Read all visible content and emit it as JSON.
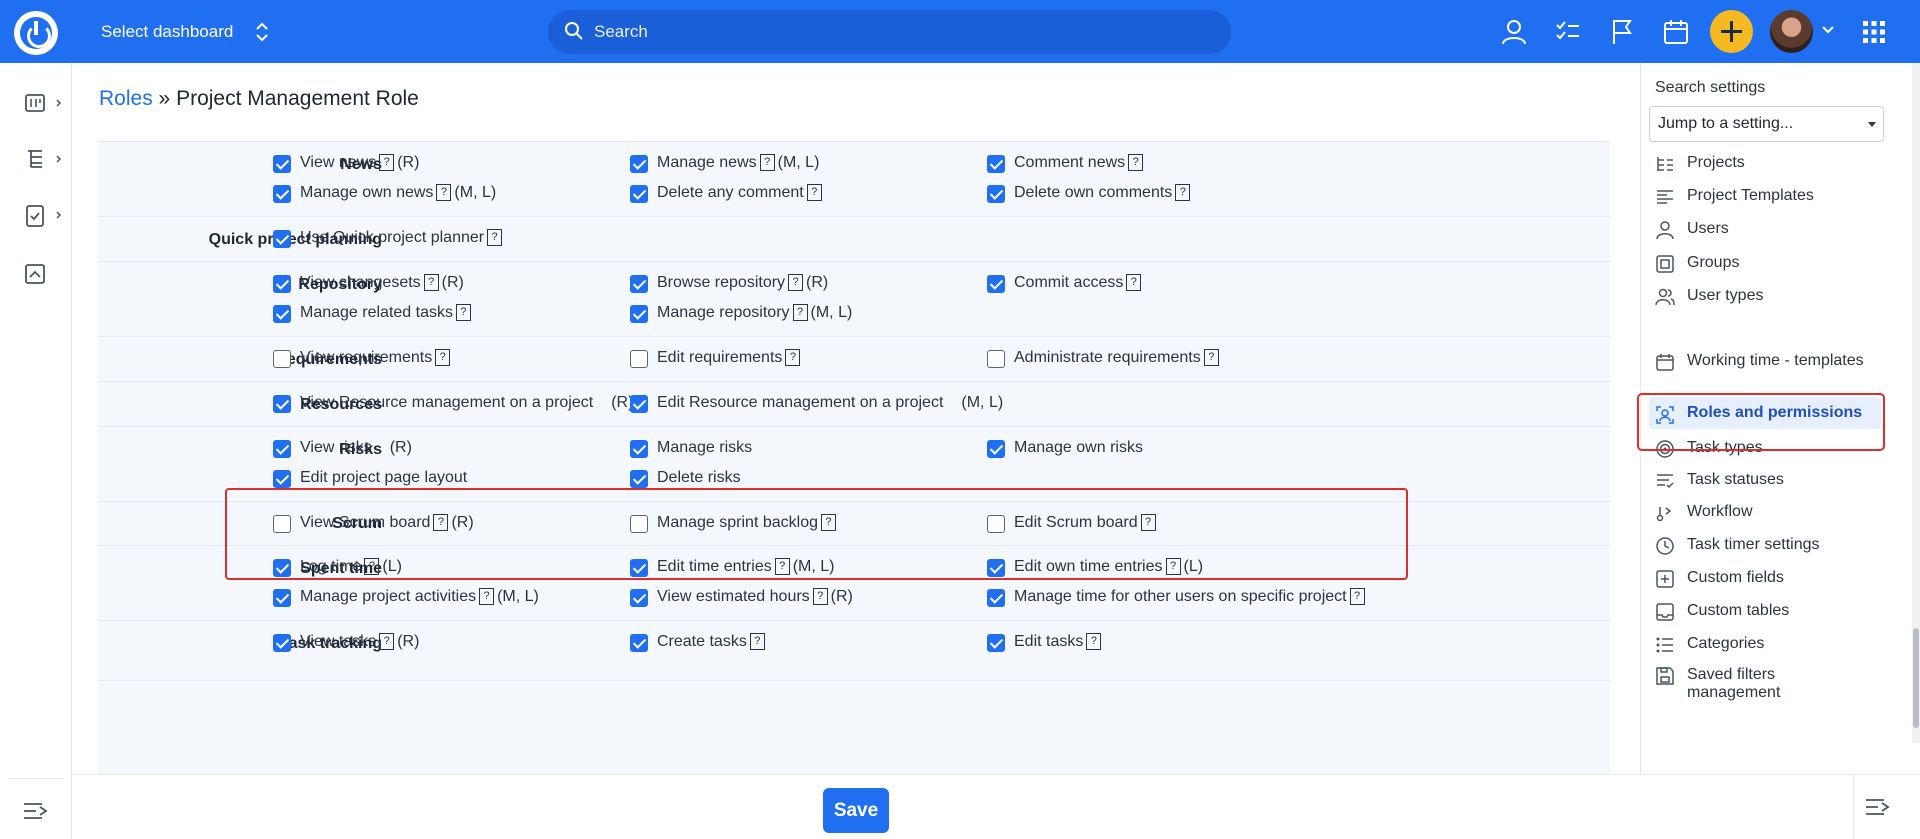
{
  "topbar": {
    "dashboard_select": "Select dashboard",
    "search_placeholder": "Search"
  },
  "breadcrumb": {
    "parent": "Roles",
    "separator": " » ",
    "current": "Project Management Role"
  },
  "permissions": {
    "help_glyph": "?",
    "sections": [
      {
        "label": "News",
        "items": [
          {
            "label": "View news",
            "help": true,
            "suffix": "(R)",
            "checked": true
          },
          {
            "label": "Manage news",
            "help": true,
            "suffix": "(M, L)",
            "checked": true
          },
          {
            "label": "Comment news",
            "help": true,
            "suffix": "",
            "checked": true
          },
          {
            "label": "Manage own news",
            "help": true,
            "suffix": "(M, L)",
            "checked": true
          },
          {
            "label": "Delete any comment",
            "help": true,
            "suffix": "",
            "checked": true
          },
          {
            "label": "Delete own comments",
            "help": true,
            "suffix": "",
            "checked": true
          }
        ]
      },
      {
        "label": "Quick project planning",
        "items": [
          {
            "label": "Use Quick project planner",
            "help": true,
            "suffix": "",
            "checked": true
          }
        ]
      },
      {
        "label": "Repository",
        "items": [
          {
            "label": "View changesets",
            "help": true,
            "suffix": "(R)",
            "checked": true
          },
          {
            "label": "Browse repository",
            "help": true,
            "suffix": "(R)",
            "checked": true
          },
          {
            "label": "Commit access",
            "help": true,
            "suffix": "",
            "checked": true
          },
          {
            "label": "Manage related tasks",
            "help": true,
            "suffix": "",
            "checked": true
          },
          {
            "label": "Manage repository",
            "help": true,
            "suffix": "(M, L)",
            "checked": true
          }
        ]
      },
      {
        "label": "Requirements",
        "items": [
          {
            "label": "View requirements",
            "help": true,
            "suffix": "",
            "checked": false
          },
          {
            "label": "Edit requirements",
            "help": true,
            "suffix": "",
            "checked": false
          },
          {
            "label": "Administrate requirements",
            "help": true,
            "suffix": "",
            "checked": false
          }
        ]
      },
      {
        "label": "Resources",
        "items": [
          {
            "label": "View Resource management on a project",
            "help": false,
            "suffix": "(R)",
            "checked": true
          },
          {
            "label": "Edit Resource management on a project",
            "help": false,
            "suffix": "(M, L)",
            "checked": true
          }
        ]
      },
      {
        "label": "Risks",
        "items": [
          {
            "label": "View risks",
            "help": false,
            "suffix": "(R)",
            "checked": true
          },
          {
            "label": "Manage risks",
            "help": false,
            "suffix": "",
            "checked": true
          },
          {
            "label": "Manage own risks",
            "help": false,
            "suffix": "",
            "checked": true
          },
          {
            "label": "Edit project page layout",
            "help": false,
            "suffix": "",
            "checked": true
          },
          {
            "label": "Delete risks",
            "help": false,
            "suffix": "",
            "checked": true
          }
        ]
      },
      {
        "label": "Scrum",
        "items": [
          {
            "label": "View Scrum board",
            "help": true,
            "suffix": "(R)",
            "checked": false
          },
          {
            "label": "Manage sprint backlog",
            "help": true,
            "suffix": "",
            "checked": false
          },
          {
            "label": "Edit Scrum board",
            "help": true,
            "suffix": "",
            "checked": false
          }
        ]
      },
      {
        "label": "Spent time",
        "items": [
          {
            "label": "Log time",
            "help": true,
            "suffix": "(L)",
            "checked": true
          },
          {
            "label": "Edit time entries",
            "help": true,
            "suffix": "(M, L)",
            "checked": true
          },
          {
            "label": "Edit own time entries",
            "help": true,
            "suffix": "(L)",
            "checked": true
          },
          {
            "label": "Manage project activities",
            "help": true,
            "suffix": "(M, L)",
            "checked": true
          },
          {
            "label": "View estimated hours",
            "help": true,
            "suffix": "(R)",
            "checked": true
          },
          {
            "label": "Manage time for other users on specific project",
            "help": true,
            "suffix": "",
            "checked": true
          }
        ]
      },
      {
        "label": "Task tracking",
        "items": [
          {
            "label": "View tasks",
            "help": true,
            "suffix": "(R)",
            "checked": true
          },
          {
            "label": "Create tasks",
            "help": true,
            "suffix": "",
            "checked": true
          },
          {
            "label": "Edit tasks",
            "help": true,
            "suffix": "",
            "checked": true
          }
        ]
      }
    ]
  },
  "footer": {
    "save_label": "Save"
  },
  "settings_panel": {
    "title": "Search settings",
    "jump_placeholder": "Jump to a setting...",
    "items": [
      {
        "label": "Projects",
        "icon": "projects-icon"
      },
      {
        "label": "Project Templates",
        "icon": "project-templates-icon"
      },
      {
        "label": "Users",
        "icon": "user-icon"
      },
      {
        "label": "Groups",
        "icon": "groups-icon"
      },
      {
        "label": "User types",
        "icon": "user-types-icon"
      },
      {
        "label": "Working time - templates",
        "icon": "calendar-icon"
      },
      {
        "label": "Roles and permissions",
        "icon": "roles-icon",
        "active": true
      },
      {
        "label": "Task types",
        "icon": "target-icon"
      },
      {
        "label": "Task statuses",
        "icon": "task-statuses-icon"
      },
      {
        "label": "Workflow",
        "icon": "workflow-icon"
      },
      {
        "label": "Task timer settings",
        "icon": "clock-icon"
      },
      {
        "label": "Custom fields",
        "icon": "plus-square-icon"
      },
      {
        "label": "Custom tables",
        "icon": "table-icon"
      },
      {
        "label": "Categories",
        "icon": "categories-icon"
      },
      {
        "label": "Saved filters management",
        "icon": "save-icon"
      }
    ]
  },
  "colors": {
    "brand_blue": "#1f6ff0",
    "add_button_yellow": "#f7b921",
    "highlight_red": "#d9302c"
  }
}
